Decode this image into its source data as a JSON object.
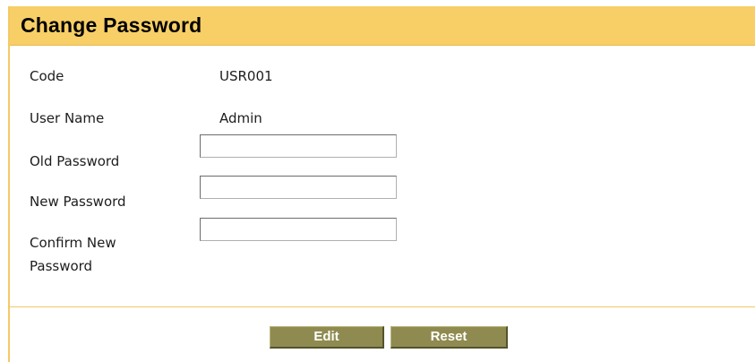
{
  "header": {
    "title": "Change Password"
  },
  "form": {
    "code": {
      "label": "Code",
      "value": "USR001"
    },
    "user_name": {
      "label": "User Name",
      "value": "Admin"
    },
    "old_password": {
      "label": "Old Password",
      "value": "",
      "placeholder": ""
    },
    "new_password": {
      "label": "New Password",
      "value": "",
      "placeholder": ""
    },
    "confirm_password": {
      "label_line1": "Confirm New",
      "label_line2": "Password",
      "value": "",
      "placeholder": ""
    }
  },
  "actions": {
    "edit_label": "Edit",
    "reset_label": "Reset"
  },
  "colors": {
    "header_bg": "#f7cf66",
    "button_bg": "#8f8b50",
    "divider": "#f4c769"
  }
}
